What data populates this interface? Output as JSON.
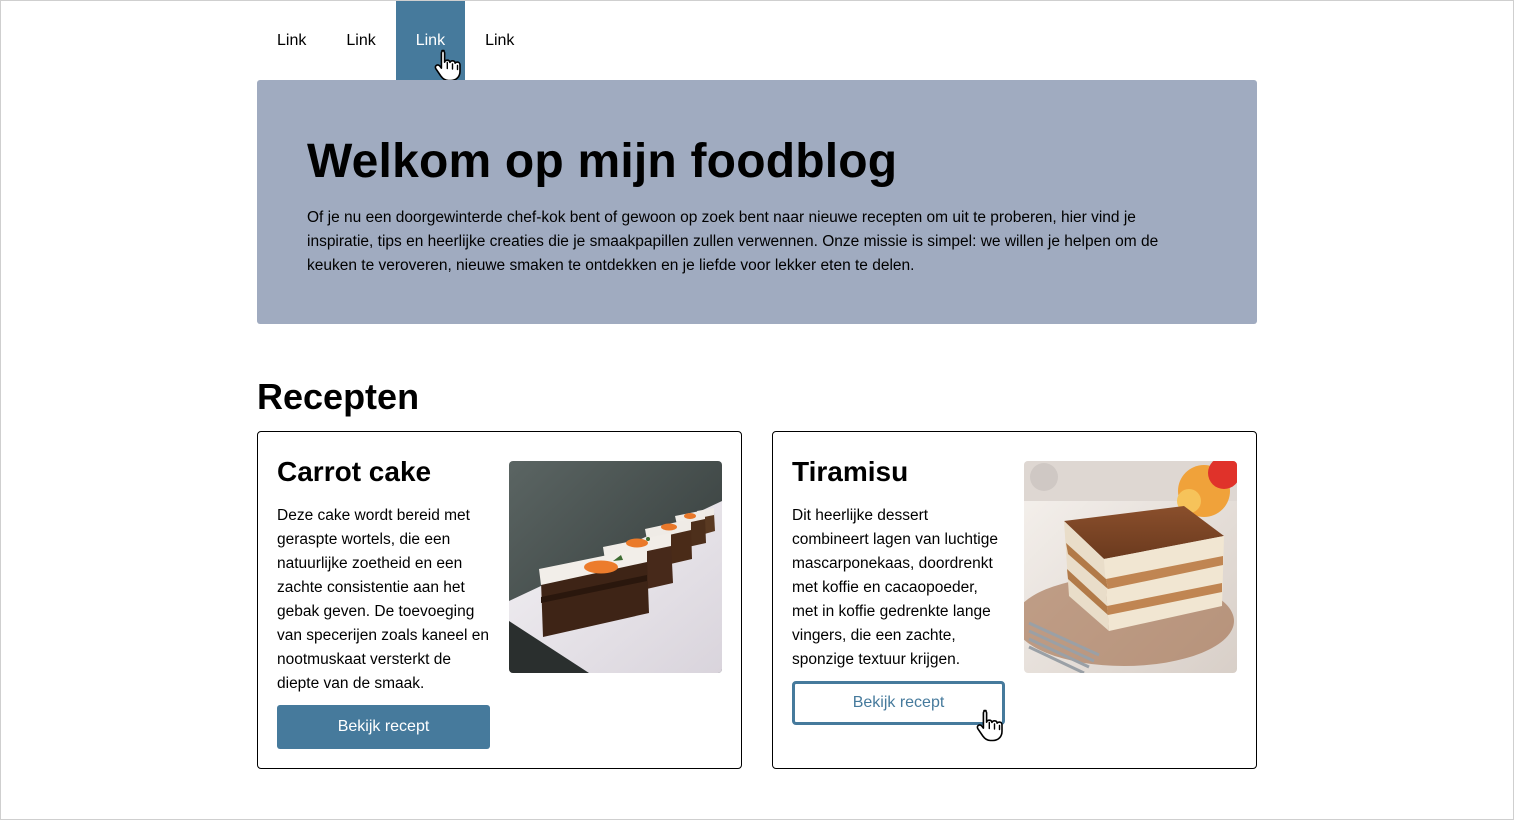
{
  "nav": {
    "links": [
      {
        "label": "Link",
        "active": false
      },
      {
        "label": "Link",
        "active": false
      },
      {
        "label": "Link",
        "active": true
      },
      {
        "label": "Link",
        "active": false
      }
    ]
  },
  "hero": {
    "title": "Welkom op mijn foodblog",
    "text": "Of je nu een doorgewinterde chef-kok bent of gewoon op zoek bent naar nieuwe recepten om uit te proberen, hier vind je inspiratie, tips en heerlijke creaties die je smaakpapillen zullen verwennen. Onze missie is simpel: we willen je helpen om de keuken te veroveren, nieuwe smaken te ontdekken en je liefde voor lekker eten te delen."
  },
  "recipes": {
    "title": "Recepten",
    "items": [
      {
        "title": "Carrot cake",
        "description": "Deze cake wordt bereid met geraspte wortels, die een natuurlijke zoetheid en een zachte consistentie aan het gebak geven. De toevoeging van specerijen zoals kaneel en nootmuskaat versterkt de diepte van de smaak.",
        "button": "Bekijk recept",
        "image_icon": "carrot-cake-photo"
      },
      {
        "title": "Tiramisu",
        "description": "Dit heerlijke dessert combineert lagen van luchtige mascarponekaas, doordrenkt met koffie en cacaopoeder, met in koffie gedrenkte lange vingers, die een zachte, sponzige textuur krijgen.",
        "button": "Bekijk recept",
        "image_icon": "tiramisu-photo"
      }
    ]
  },
  "colors": {
    "accent": "#467a9c",
    "hero_bg": "#a0abc0"
  }
}
